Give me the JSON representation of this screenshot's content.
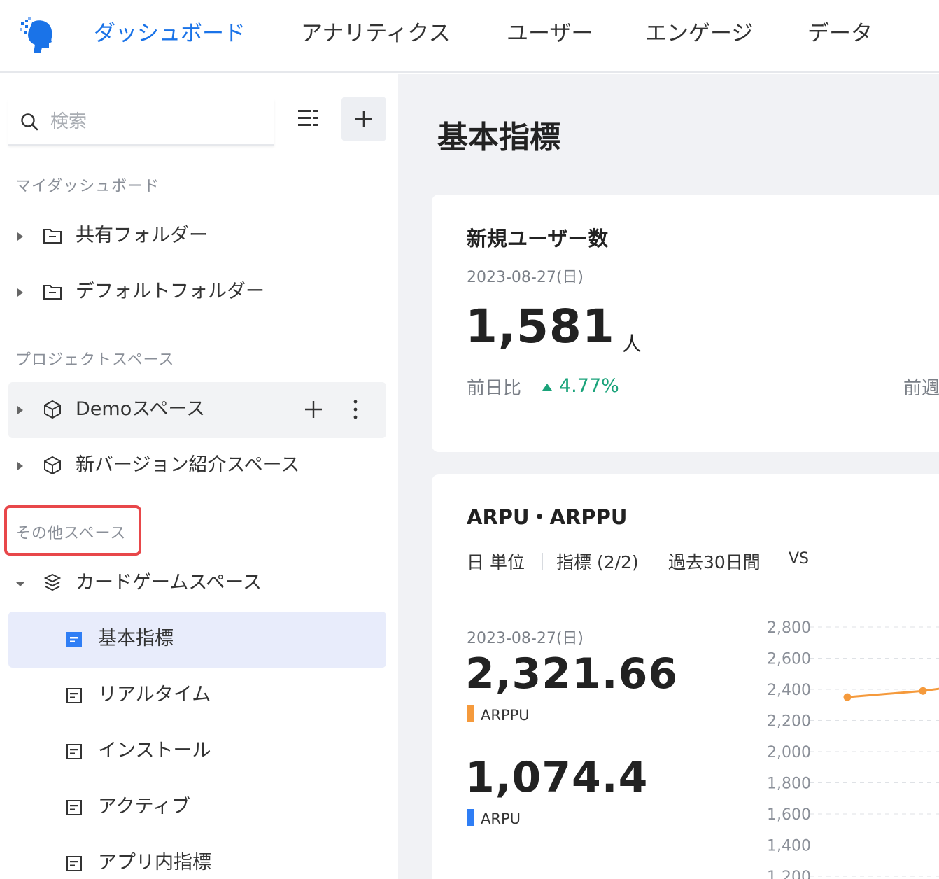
{
  "header": {
    "nav": [
      {
        "label": "ダッシュボード",
        "active": true
      },
      {
        "label": "アナリティクス",
        "active": false
      },
      {
        "label": "ユーザー",
        "active": false
      },
      {
        "label": "エンゲージ",
        "active": false
      },
      {
        "label": "データ",
        "active": false
      }
    ]
  },
  "sidebar": {
    "search": {
      "placeholder": "検索",
      "value": ""
    },
    "add_symbol": "+",
    "sections": {
      "my_dashboard": "マイダッシュボード",
      "project_space": "プロジェクトスペース",
      "other_space": "その他スペース"
    },
    "my_dashboard_items": [
      "共有フォルダー",
      "デフォルトフォルダー"
    ],
    "project_space_items": [
      "Demoスペース",
      "新バージョン紹介スペース"
    ],
    "other_space_items": {
      "space": "カードゲームスペース",
      "dashboards": [
        "基本指標",
        "リアルタイム",
        "インストール",
        "アクティブ",
        "アプリ内指標"
      ]
    }
  },
  "main": {
    "page_title": "基本指標",
    "new_users_card": {
      "title": "新規ユーザー数",
      "date": "2023-08-27(日)",
      "value": "1,581",
      "unit": "人",
      "compare_label": "前日比",
      "compare_value": "4.77%",
      "compare_label_2": "前週"
    },
    "arpu_card": {
      "title": "ARPU・ARPPU",
      "filters": [
        "日 単位",
        "指標 (2/2)",
        "過去30日間",
        "VS"
      ],
      "date": "2023-08-27(日)",
      "metrics": [
        {
          "value": "2,321.66",
          "label": "ARPPU",
          "color": "#f59a3c"
        },
        {
          "value": "1,074.4",
          "label": "ARPU",
          "color": "#2f7ef5"
        }
      ]
    }
  },
  "colors": {
    "accent": "#1a73e8",
    "positive": "#1aa37a",
    "highlight_border": "#e8474a",
    "arppu_line": "#f59a3c"
  },
  "chart_data": {
    "type": "line",
    "yticks": [
      "2,800",
      "2,600",
      "2,400",
      "2,200",
      "2,000",
      "1,800",
      "1,600",
      "1,400",
      "1,200"
    ],
    "ylim": [
      1200,
      2800
    ],
    "series": [
      {
        "name": "ARPPU",
        "color": "#f59a3c",
        "values": [
          2350,
          2390
        ]
      }
    ]
  }
}
